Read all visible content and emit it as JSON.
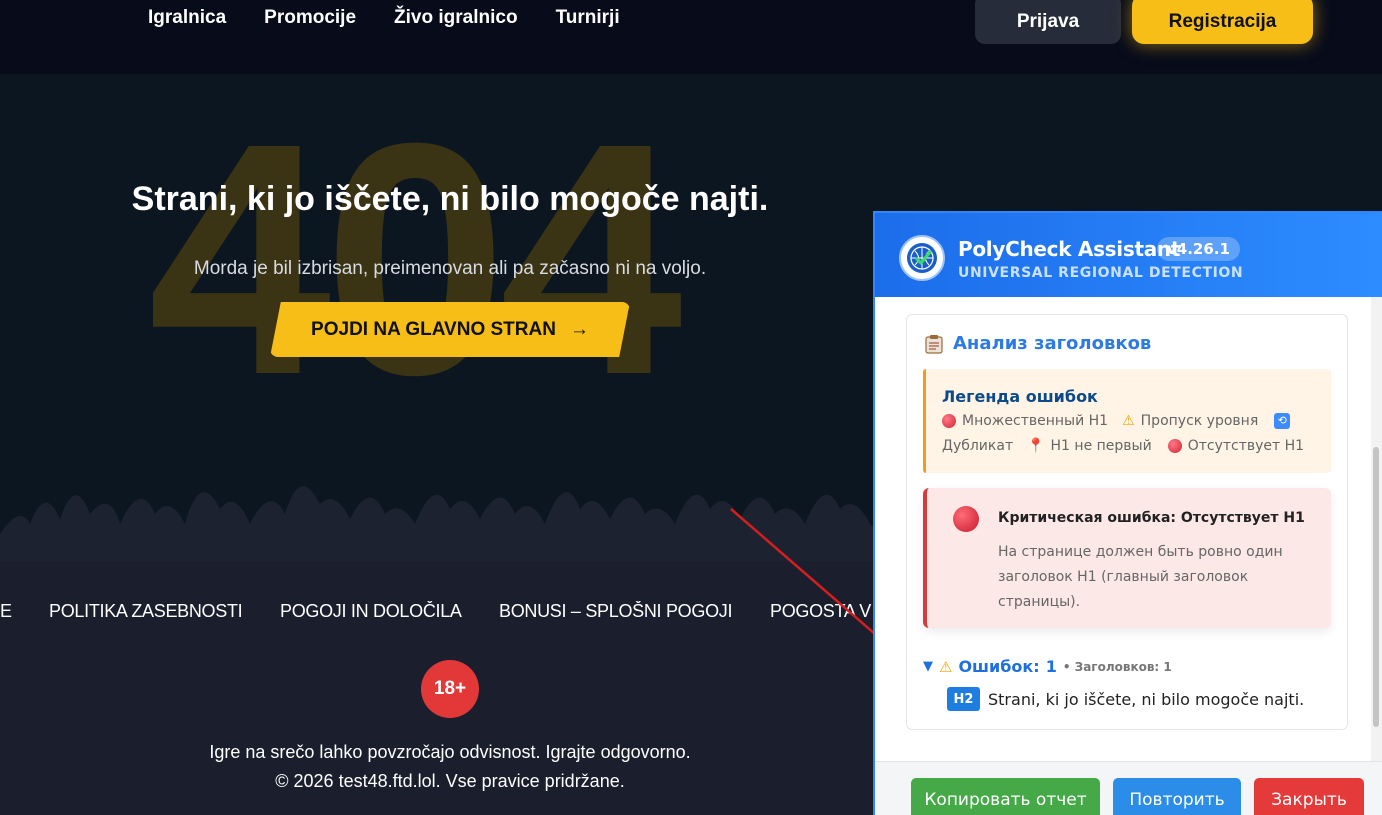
{
  "site": {
    "nav": [
      "Igralnica",
      "Promocije",
      "Živo igralnico",
      "Turnirji"
    ],
    "login_label": "Prijava",
    "register_label": "Registracija",
    "colors": {
      "accent": "#f7be18",
      "background": "#0c1620",
      "header": "#070b1a"
    }
  },
  "hero": {
    "code": "404",
    "title": "Strani, ki jo iščete, ni bilo mogoče najti.",
    "subtitle": "Morda je bil izbrisan, preimenovan ali pa začasno ni na voljo.",
    "button_label": "POJDI NA GLAVNO STRAN",
    "button_arrow": "→"
  },
  "footer": {
    "links": [
      "E",
      "POLITIKA ZASEBNOSTI",
      "POGOJI IN DOLOČILA",
      "BONUSI – SPLOŠNI POGOJI",
      "POGOSTA V"
    ],
    "age_badge": "18+",
    "note": "Igre na srečo lahko povzročajo odvisnost. Igrajte odgovorno.",
    "copyright": "© 2026 test48.ftd.lol. Vse pravice pridržane."
  },
  "panel": {
    "title": "PolyCheck Assistant",
    "version": "v4.26.1",
    "subtitle": "UNIVERSAL REGIONAL DETECTION",
    "section_icon": "clipboard-icon",
    "section_title": "Анализ заголовков",
    "legend": {
      "title": "Легенда ошибок",
      "items": {
        "multiple_h1": "Множественный H1",
        "level_skip": "Пропуск уровня",
        "duplicate": "Дубликат",
        "h1_not_first": "H1 не первый",
        "missing_h1": "Отсутствует H1"
      }
    },
    "error": {
      "title": "Критическая ошибка: Отсутствует H1",
      "text": "На странице должен быть ровно один заголовок H1 (главный заголовок страницы)."
    },
    "summary": {
      "caret": "▼",
      "errors_label": "Ошибок:",
      "errors_count": "1",
      "headings_meta": "• Заголовков: 1"
    },
    "heading": {
      "tag": "H2",
      "text": "Strani, ki jo iščete, ni bilo mogoče najti."
    },
    "buttons": {
      "copy": "Копировать отчет",
      "retry": "Повторить",
      "close": "Закрыть"
    },
    "colors": {
      "header": "#2d8cff",
      "copy": "#45a948",
      "retry": "#2b8de8",
      "close": "#e43a3a"
    }
  }
}
